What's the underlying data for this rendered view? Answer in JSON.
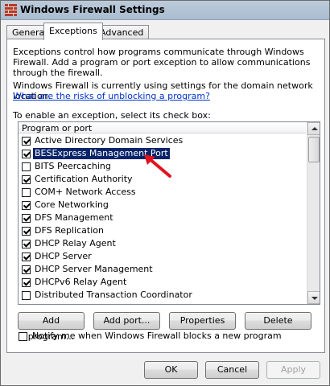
{
  "window": {
    "title": "Windows Firewall Settings",
    "icon": "firewall-icon"
  },
  "tabs": [
    {
      "label": "General",
      "active": false
    },
    {
      "label": "Exceptions",
      "active": true
    },
    {
      "label": "Advanced",
      "active": false
    }
  ],
  "intro_text": "Exceptions control how programs communicate through Windows Firewall. Add a program or port exception to allow communications through the firewall.",
  "status_text": "Windows Firewall is currently using settings for the domain network location.",
  "risk_link": "What are the risks of unblocking a program?",
  "list_instruction": "To enable an exception, select its check box:",
  "list": {
    "column_header": "Program or port",
    "items": [
      {
        "label": "Active Directory Domain Services",
        "checked": true,
        "selected": false
      },
      {
        "label": "BESExpress Management Port",
        "checked": true,
        "selected": true
      },
      {
        "label": "BITS Peercaching",
        "checked": false,
        "selected": false
      },
      {
        "label": "Certification Authority",
        "checked": true,
        "selected": false
      },
      {
        "label": "COM+ Network Access",
        "checked": false,
        "selected": false
      },
      {
        "label": "Core Networking",
        "checked": true,
        "selected": false
      },
      {
        "label": "DFS Management",
        "checked": true,
        "selected": false
      },
      {
        "label": "DFS Replication",
        "checked": true,
        "selected": false
      },
      {
        "label": "DHCP Relay Agent",
        "checked": true,
        "selected": false
      },
      {
        "label": "DHCP Server",
        "checked": true,
        "selected": false
      },
      {
        "label": "DHCP Server Management",
        "checked": true,
        "selected": false
      },
      {
        "label": "DHCPv6 Relay Agent",
        "checked": true,
        "selected": false
      },
      {
        "label": "Distributed Transaction Coordinator",
        "checked": false,
        "selected": false
      }
    ]
  },
  "action_buttons": {
    "add_program": "Add program...",
    "add_port": "Add port...",
    "properties": "Properties",
    "delete": "Delete"
  },
  "notify_label": "Notify me when Windows Firewall blocks a new program",
  "notify_checked": false,
  "footer_buttons": {
    "ok": "OK",
    "cancel": "Cancel",
    "apply": "Apply"
  },
  "colors": {
    "selection": "#0a246a",
    "link": "#0033cc",
    "pointer_arrow": "#e0141e"
  }
}
